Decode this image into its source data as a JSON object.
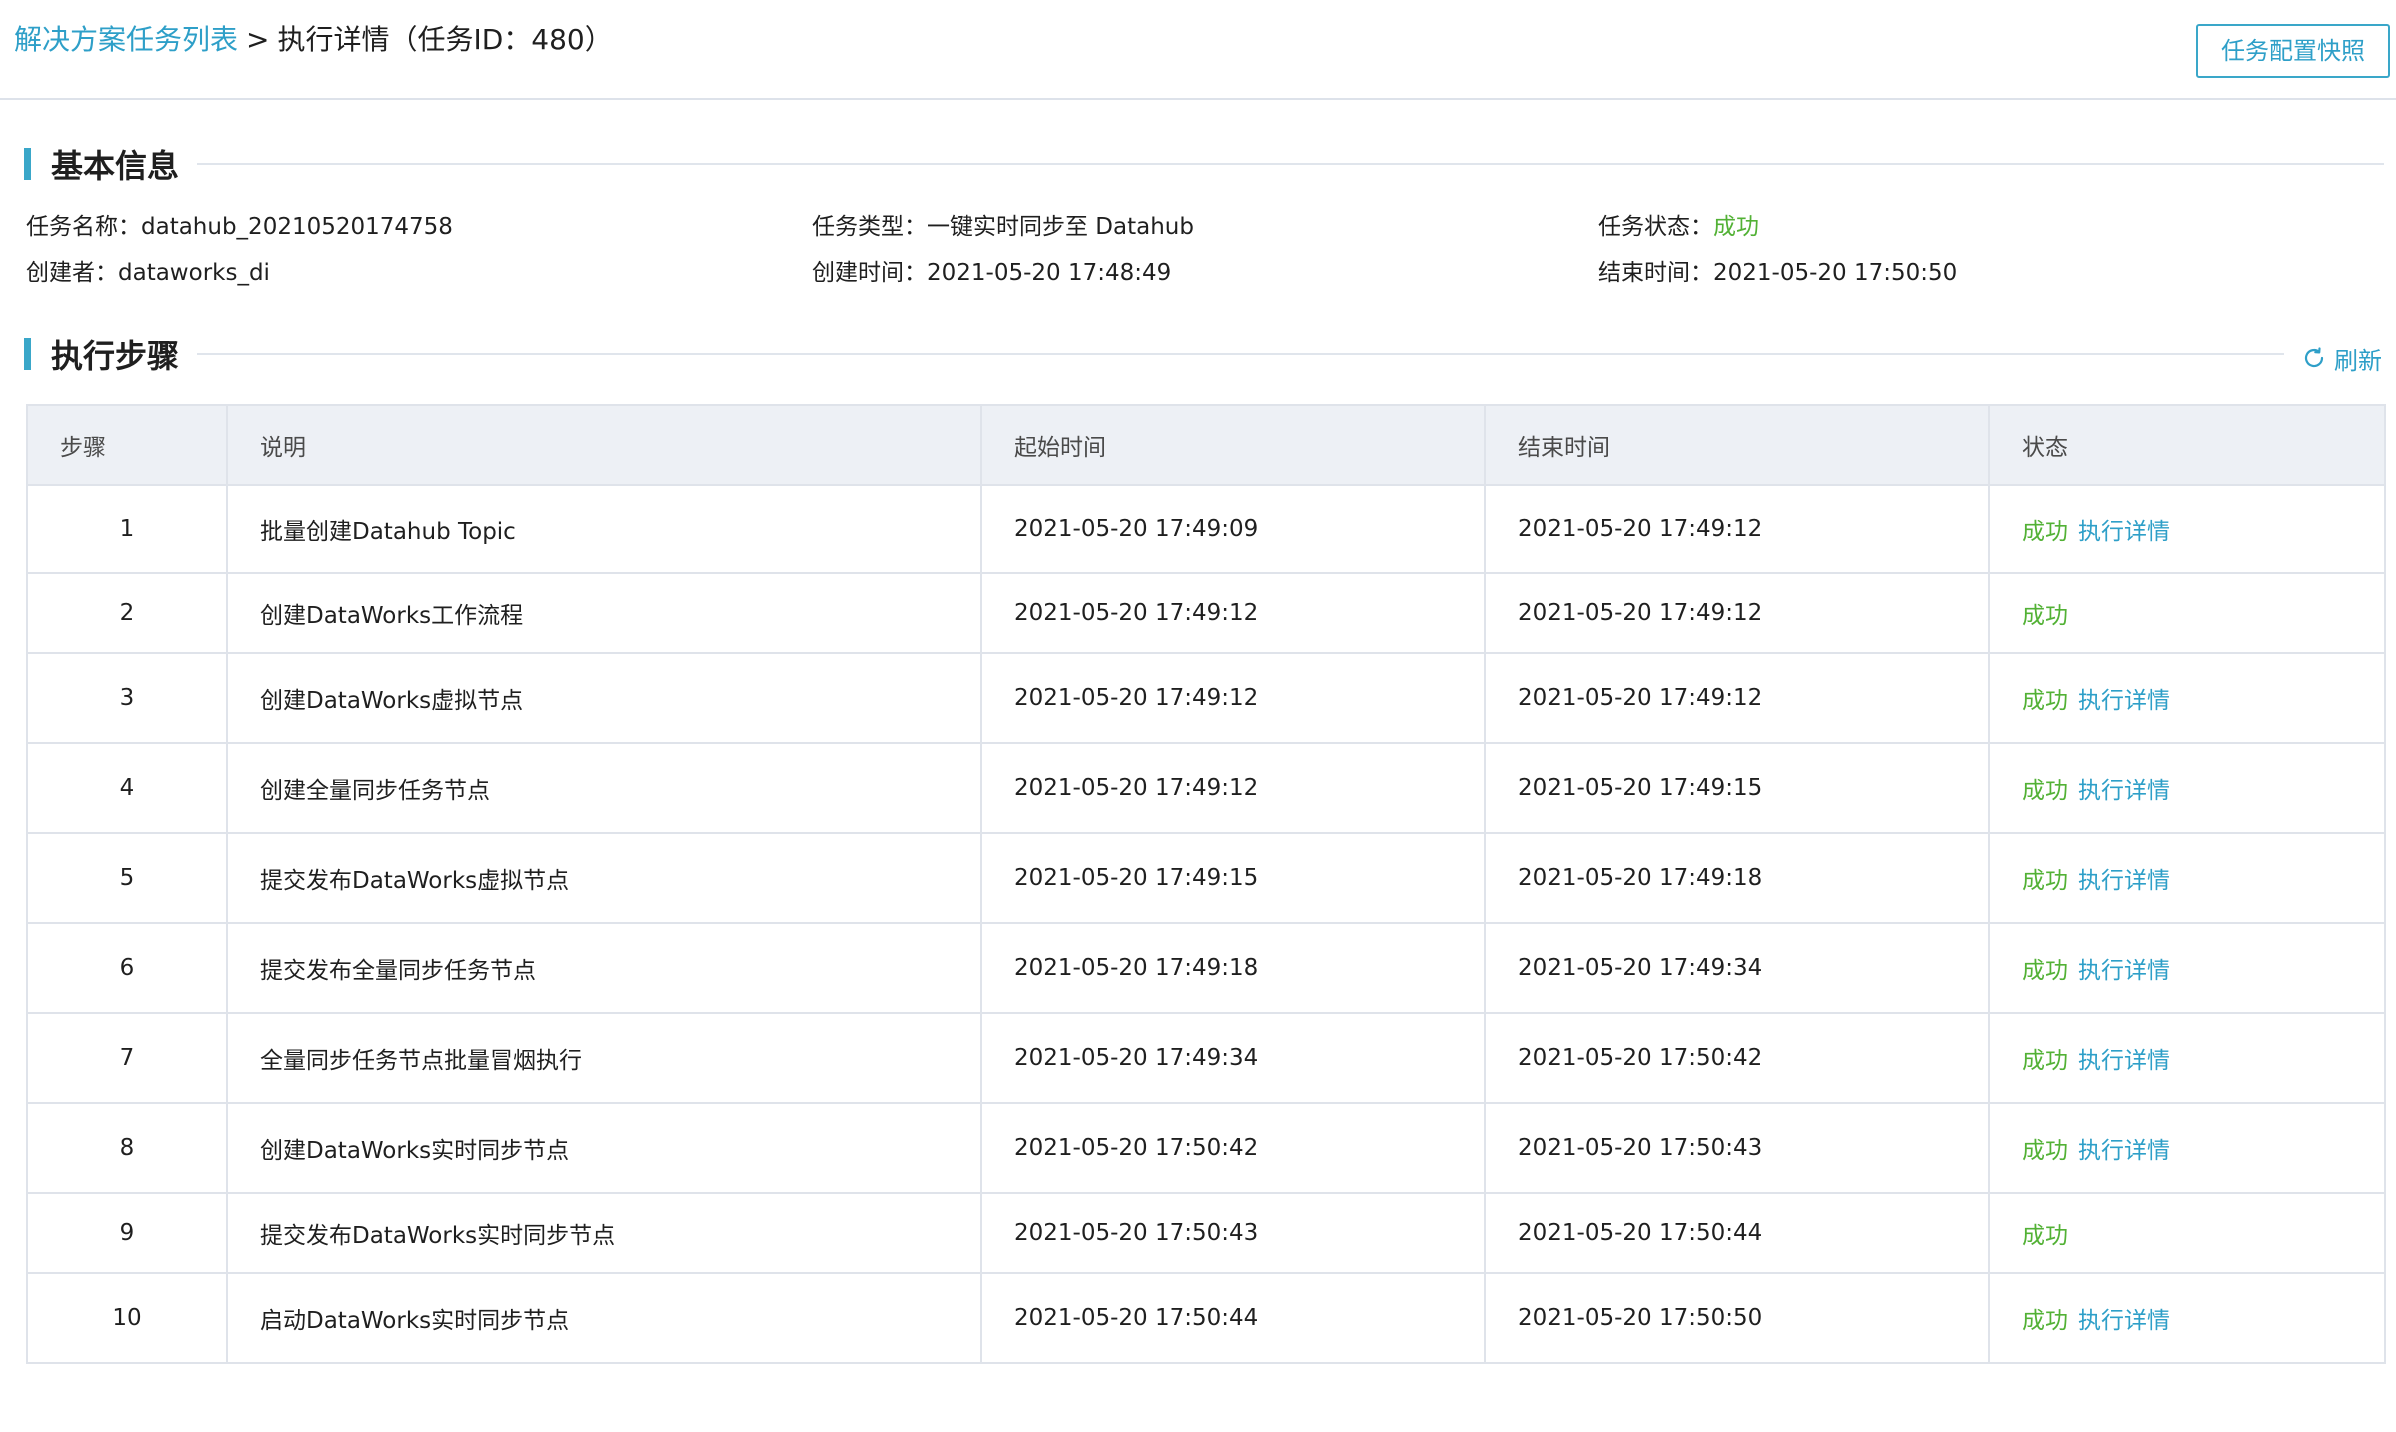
{
  "header": {
    "breadcrumb_link": "解决方案任务列表",
    "breadcrumb_sep": ">",
    "breadcrumb_current": "执行详情（任务ID：480）",
    "snapshot_button": "任务配置快照"
  },
  "basic_info": {
    "title": "基本信息",
    "task_name_label": "任务名称：",
    "task_name": "datahub_20210520174758",
    "task_type_label": "任务类型：",
    "task_type": "一键实时同步至 Datahub",
    "task_status_label": "任务状态：",
    "task_status": "成功",
    "creator_label": "创建者：",
    "creator": "dataworks_di",
    "created_label": "创建时间：",
    "created": "2021-05-20 17:48:49",
    "ended_label": "结束时间：",
    "ended": "2021-05-20 17:50:50"
  },
  "steps_section": {
    "title": "执行步骤",
    "refresh": "刷新"
  },
  "table": {
    "columns": [
      "步骤",
      "说明",
      "起始时间",
      "结束时间",
      "状态"
    ],
    "rows": [
      {
        "step": "1",
        "desc": "批量创建Datahub Topic",
        "start": "2021-05-20 17:49:09",
        "end": "2021-05-20 17:49:12",
        "status": "成功",
        "detail": "执行详情"
      },
      {
        "step": "2",
        "desc": "创建DataWorks工作流程",
        "start": "2021-05-20 17:49:12",
        "end": "2021-05-20 17:49:12",
        "status": "成功",
        "detail": ""
      },
      {
        "step": "3",
        "desc": "创建DataWorks虚拟节点",
        "start": "2021-05-20 17:49:12",
        "end": "2021-05-20 17:49:12",
        "status": "成功",
        "detail": "执行详情"
      },
      {
        "step": "4",
        "desc": "创建全量同步任务节点",
        "start": "2021-05-20 17:49:12",
        "end": "2021-05-20 17:49:15",
        "status": "成功",
        "detail": "执行详情"
      },
      {
        "step": "5",
        "desc": "提交发布DataWorks虚拟节点",
        "start": "2021-05-20 17:49:15",
        "end": "2021-05-20 17:49:18",
        "status": "成功",
        "detail": "执行详情"
      },
      {
        "step": "6",
        "desc": "提交发布全量同步任务节点",
        "start": "2021-05-20 17:49:18",
        "end": "2021-05-20 17:49:34",
        "status": "成功",
        "detail": "执行详情"
      },
      {
        "step": "7",
        "desc": "全量同步任务节点批量冒烟执行",
        "start": "2021-05-20 17:49:34",
        "end": "2021-05-20 17:50:42",
        "status": "成功",
        "detail": "执行详情"
      },
      {
        "step": "8",
        "desc": "创建DataWorks实时同步节点",
        "start": "2021-05-20 17:50:42",
        "end": "2021-05-20 17:50:43",
        "status": "成功",
        "detail": "执行详情"
      },
      {
        "step": "9",
        "desc": "提交发布DataWorks实时同步节点",
        "start": "2021-05-20 17:50:43",
        "end": "2021-05-20 17:50:44",
        "status": "成功",
        "detail": ""
      },
      {
        "step": "10",
        "desc": "启动DataWorks实时同步节点",
        "start": "2021-05-20 17:50:44",
        "end": "2021-05-20 17:50:50",
        "status": "成功",
        "detail": "执行详情"
      }
    ]
  }
}
